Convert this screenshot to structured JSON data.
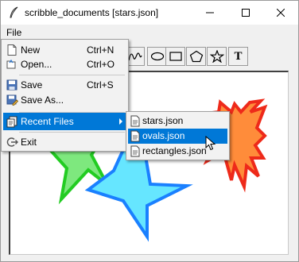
{
  "window": {
    "title": "scribble_documents [stars.json]"
  },
  "menubar": {
    "file": "File"
  },
  "toolbar": {
    "tools": [
      "freehand-tool-icon",
      "oval-tool-icon",
      "rectangle-tool-icon",
      "polygon-tool-icon",
      "star-tool-icon",
      "text-tool-icon"
    ],
    "text_tool_label": "T"
  },
  "file_menu": {
    "new": {
      "label": "New",
      "shortcut": "Ctrl+N",
      "icon": "new-document-icon"
    },
    "open": {
      "label": "Open...",
      "shortcut": "Ctrl+O",
      "icon": "open-folder-icon"
    },
    "save": {
      "label": "Save",
      "shortcut": "Ctrl+S",
      "icon": "floppy-disk-icon"
    },
    "save_as": {
      "label": "Save As...",
      "icon": "save-as-icon"
    },
    "recent": {
      "label": "Recent Files",
      "icon": "recent-files-icon"
    },
    "exit": {
      "label": "Exit",
      "icon": "exit-icon"
    }
  },
  "recent_files": [
    {
      "label": "stars.json",
      "icon": "json-file-icon"
    },
    {
      "label": "ovals.json",
      "icon": "json-file-icon"
    },
    {
      "label": "rectangles.json",
      "icon": "json-file-icon"
    }
  ],
  "colors": {
    "highlight": "#0078d7",
    "green_star_fill": "#7ee87e",
    "green_star_stroke": "#22cc22",
    "blue_star_fill": "#66e6ff",
    "blue_star_stroke": "#1a80ff",
    "red_star_fill": "#ff8c3a",
    "red_star_stroke": "#ee2a1a"
  }
}
